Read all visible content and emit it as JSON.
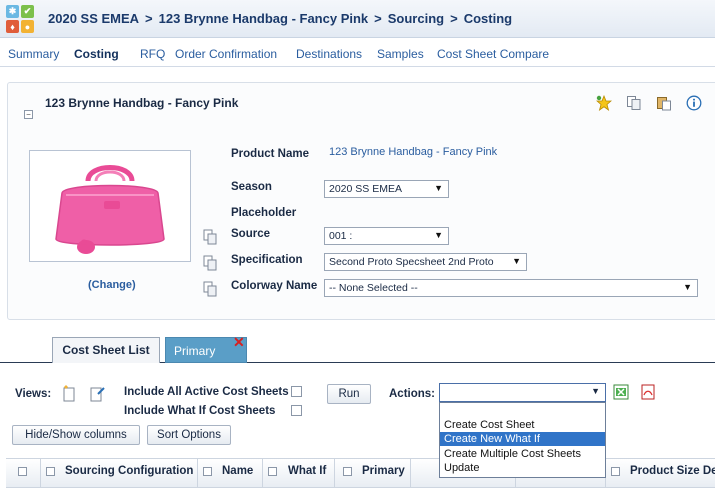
{
  "header": {
    "breadcrumbs": [
      "2020 SS EMEA",
      "123 Brynne Handbag - Fancy Pink",
      "Sourcing",
      "Costing"
    ],
    "separator": ">"
  },
  "nav_tabs": [
    {
      "label": "Summary",
      "active": false
    },
    {
      "label": "Costing",
      "active": true
    },
    {
      "label": "RFQ",
      "active": false
    },
    {
      "label": "Order Confirmation",
      "active": false
    },
    {
      "label": "Destinations",
      "active": false
    },
    {
      "label": "Samples",
      "active": false
    },
    {
      "label": "Cost Sheet Compare",
      "active": false
    }
  ],
  "product": {
    "title": "123 Brynne Handbag - Fancy Pink",
    "change_label": "(Change)",
    "collapse_symbol": "−",
    "fields": {
      "product_name_label": "Product Name",
      "product_name_value": "123 Brynne Handbag - Fancy Pink",
      "season_label": "Season",
      "season_value": "2020 SS EMEA",
      "placeholder_label": "Placeholder",
      "source_label": "Source",
      "source_value": "001 :",
      "specification_label": "Specification",
      "specification_value": "Second Proto Specsheet 2nd Proto",
      "colorway_label": "Colorway Name",
      "colorway_value": "-- None Selected --"
    },
    "toolbar_icons": [
      "favorite-star-icon",
      "copy-icon",
      "paste-icon",
      "info-icon"
    ]
  },
  "cost_tabs": {
    "list_label": "Cost Sheet List",
    "primary_label": "Primary",
    "close_symbol": "✕"
  },
  "views": {
    "label": "Views:",
    "include_active_label": "Include All Active Cost Sheets",
    "include_whatif_label": "Include What If Cost Sheets",
    "run_label": "Run",
    "actions_label": "Actions:",
    "hide_show_label": "Hide/Show columns",
    "sort_label": "Sort Options",
    "action_options": [
      "Create Cost Sheet",
      "Create New What If",
      "Create Multiple Cost Sheets",
      "Update"
    ],
    "highlighted_option": "Create New What If"
  },
  "grid": {
    "columns": [
      "Sourcing Configuration",
      "Name",
      "What If",
      "Primary",
      "Product Size De"
    ]
  },
  "colors": {
    "accent": "#2a5d9f",
    "primary_tab": "#5a9ec7",
    "highlight": "#3074c8",
    "bag_pink": "#ef5fa7"
  }
}
